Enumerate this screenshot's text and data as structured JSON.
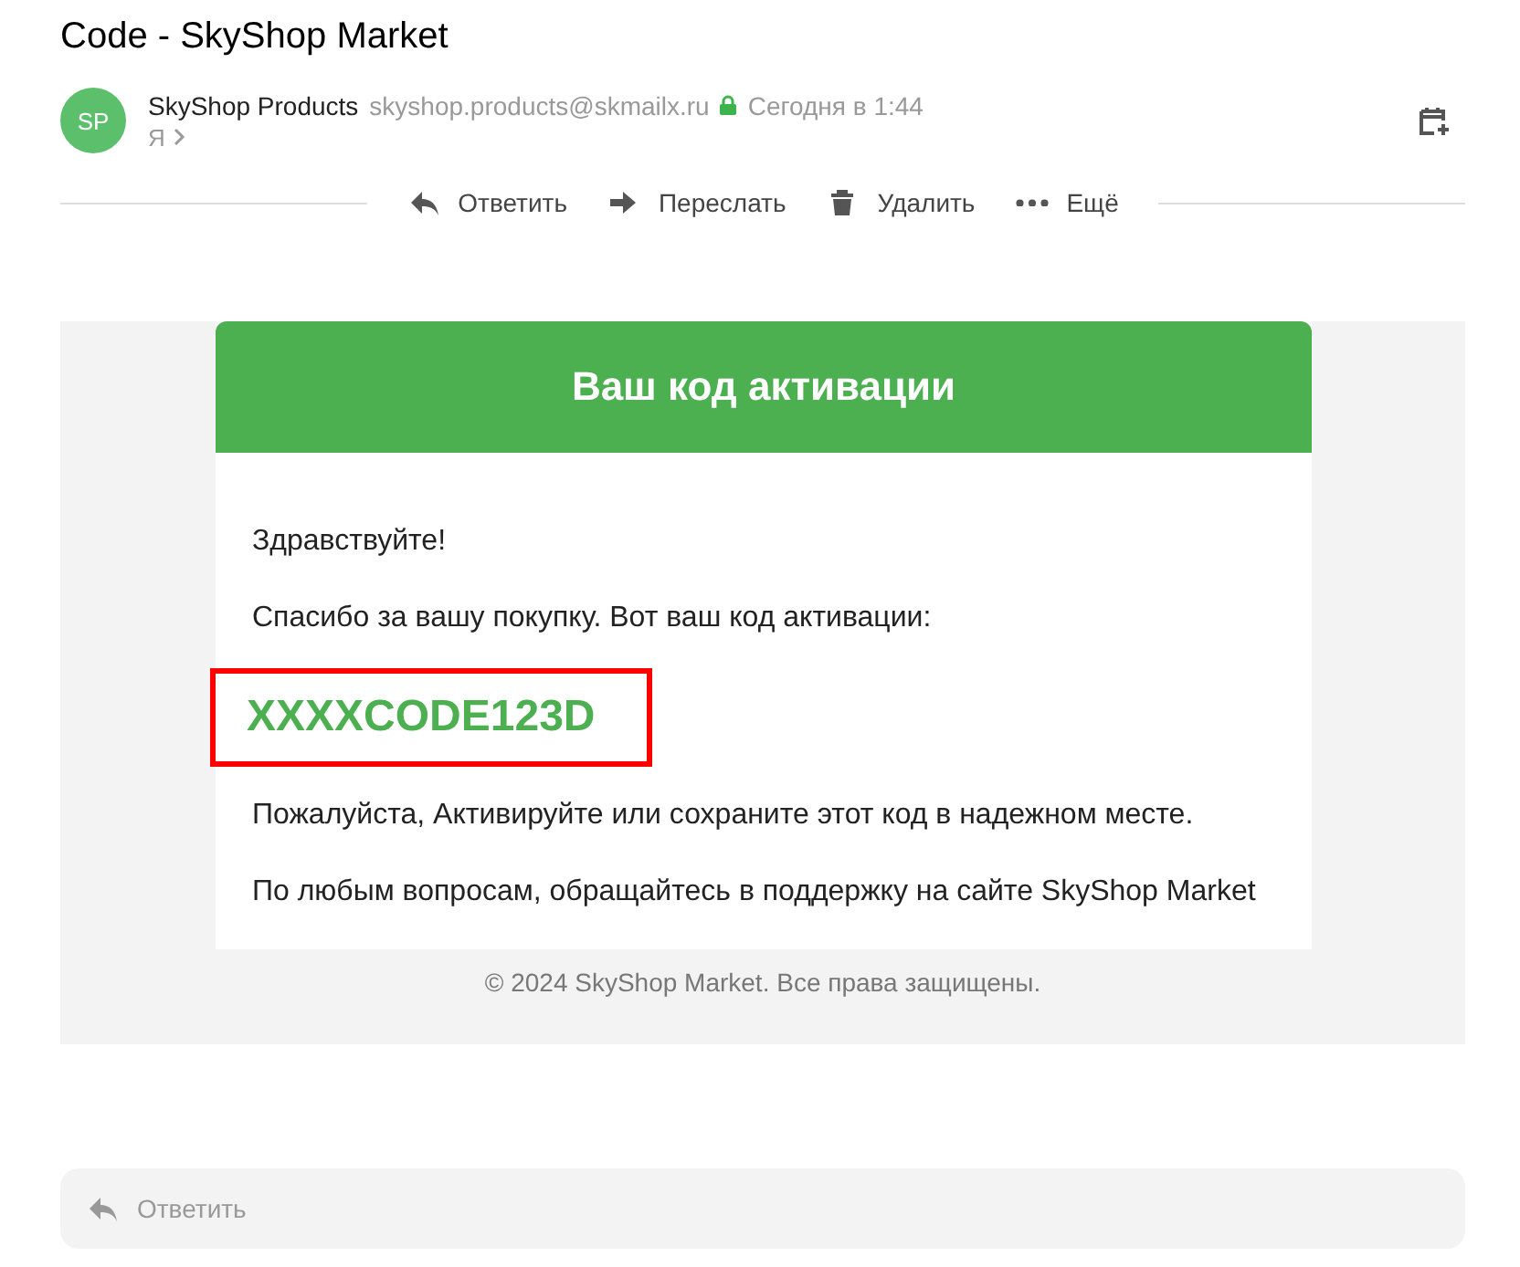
{
  "subject": "Code - SkyShop Market",
  "sender": {
    "avatar": "SP",
    "name": "SkyShop Products",
    "email": "skyshop.products@skmailx.ru",
    "secure": true,
    "date": "Сегодня в 1:44",
    "recipient": "Я"
  },
  "actions": [
    {
      "kind": "reply",
      "label": "Ответить"
    },
    {
      "kind": "forward",
      "label": "Переслать"
    },
    {
      "kind": "delete",
      "label": "Удалить"
    },
    {
      "kind": "more",
      "label": "Ещё"
    }
  ],
  "email": {
    "heading": "Ваш код активации",
    "greeting": "Здравствуйте!",
    "intro": "Спасибо за вашу покупку. Вот ваш код активации:",
    "code": "XXXXCODE123D",
    "instruction": "Пожалуйста, Активируйте или сохраните этот код в надежном месте.",
    "support": "По любым вопросам, обращайтесь в поддержку на сайте SkyShop Market",
    "footer": "© 2024 SkyShop Market. Все права защищены."
  },
  "reply_bar": {
    "label": "Ответить"
  }
}
